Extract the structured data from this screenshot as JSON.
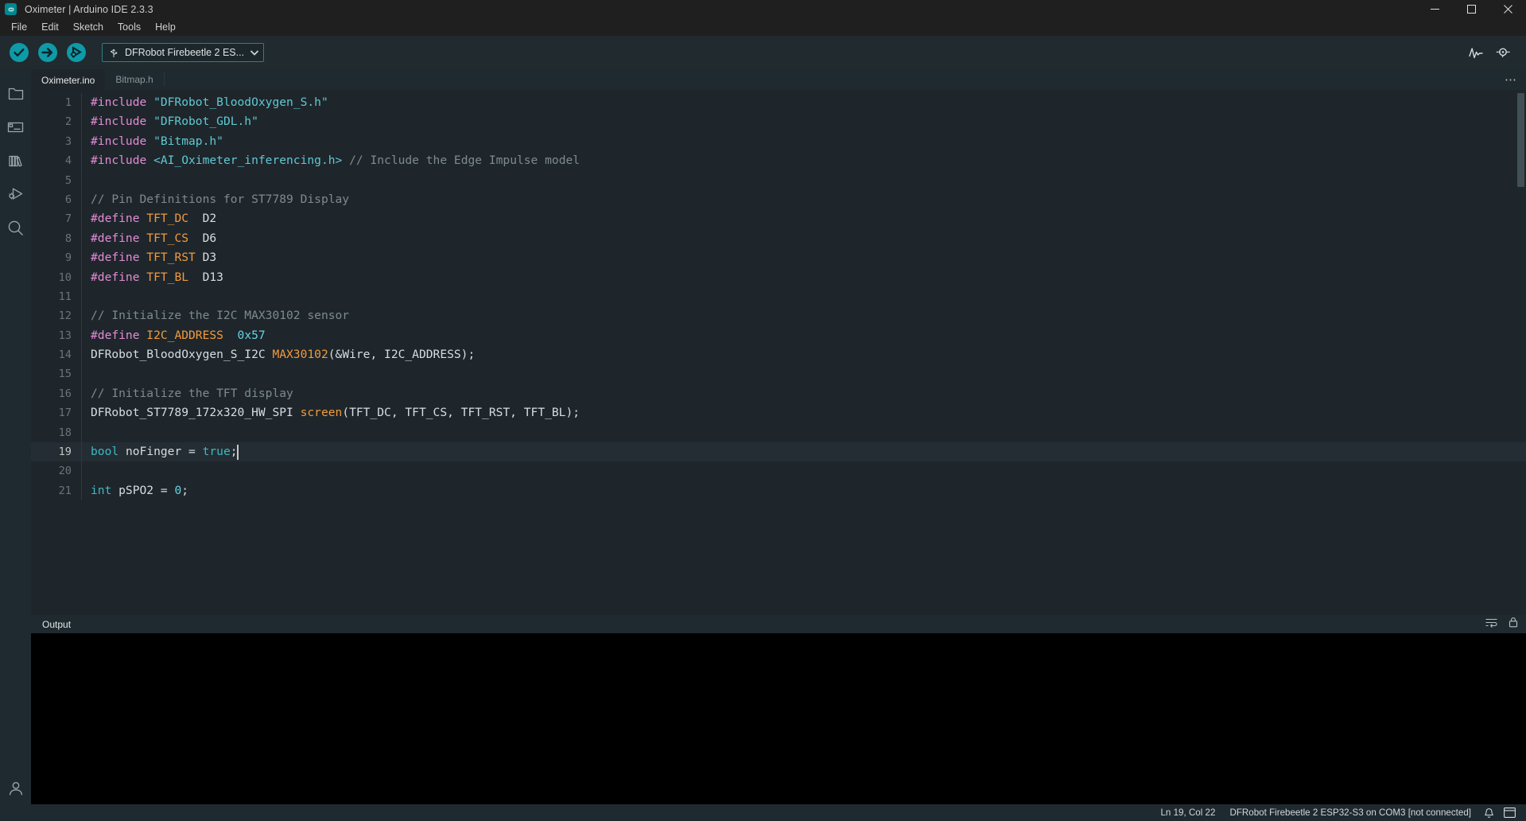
{
  "window": {
    "title": "Oximeter | Arduino IDE 2.3.3",
    "logo_icon": "arduino-infinity-logo",
    "minimize_icon": "minimize-icon",
    "maximize_icon": "maximize-icon",
    "close_icon": "close-icon"
  },
  "menubar": {
    "items": [
      {
        "label": "File",
        "name": "menu-file"
      },
      {
        "label": "Edit",
        "name": "menu-edit"
      },
      {
        "label": "Sketch",
        "name": "menu-sketch"
      },
      {
        "label": "Tools",
        "name": "menu-tools"
      },
      {
        "label": "Help",
        "name": "menu-help"
      }
    ]
  },
  "toolbar": {
    "verify_icon": "verify-checkmark-icon",
    "upload_icon": "upload-arrow-icon",
    "debug_icon": "debug-icon",
    "board_selector": {
      "usb_icon": "usb-icon",
      "value": "DFRobot Firebeetle 2 ES...",
      "caret_icon": "chevron-down-icon"
    },
    "serial_plotter_icon": "serial-plotter-icon",
    "serial_monitor_icon": "serial-monitor-icon"
  },
  "activitybar": {
    "items": [
      {
        "label": "Sketchbook",
        "name": "sidebar-item-sketchbook",
        "icon": "folder-icon"
      },
      {
        "label": "Boards Manager",
        "name": "sidebar-item-boards-manager",
        "icon": "board-icon"
      },
      {
        "label": "Library Manager",
        "name": "sidebar-item-library-manager",
        "icon": "library-books-icon"
      },
      {
        "label": "Debug",
        "name": "sidebar-item-debug",
        "icon": "debug-play-bug-icon"
      },
      {
        "label": "Search",
        "name": "sidebar-item-search",
        "icon": "search-icon"
      }
    ],
    "account_icon": "account-person-icon"
  },
  "tabs": {
    "items": [
      {
        "label": "Oximeter.ino",
        "name": "tab-oximeter-ino",
        "active": true
      },
      {
        "label": "Bitmap.h",
        "name": "tab-bitmap-h",
        "active": false
      }
    ],
    "more_label": "⋯"
  },
  "editor": {
    "current_line": 19,
    "lines": [
      {
        "n": "1",
        "tokens": [
          {
            "t": "#include ",
            "c": "t-pre"
          },
          {
            "t": "\"DFRobot_BloodOxygen_S.h\"",
            "c": "t-str"
          }
        ]
      },
      {
        "n": "2",
        "tokens": [
          {
            "t": "#include ",
            "c": "t-pre"
          },
          {
            "t": "\"DFRobot_GDL.h\"",
            "c": "t-str"
          }
        ]
      },
      {
        "n": "3",
        "tokens": [
          {
            "t": "#include ",
            "c": "t-pre"
          },
          {
            "t": "\"Bitmap.h\"",
            "c": "t-str"
          }
        ]
      },
      {
        "n": "4",
        "tokens": [
          {
            "t": "#include ",
            "c": "t-pre"
          },
          {
            "t": "<AI_Oximeter_inferencing.h>",
            "c": "t-str"
          },
          {
            "t": " ",
            "c": "t-txt"
          },
          {
            "t": "// Include the Edge Impulse model",
            "c": "t-cmt"
          }
        ]
      },
      {
        "n": "5",
        "tokens": []
      },
      {
        "n": "6",
        "tokens": [
          {
            "t": "// Pin Definitions for ST7789 Display",
            "c": "t-cmt"
          }
        ]
      },
      {
        "n": "7",
        "tokens": [
          {
            "t": "#define ",
            "c": "t-pre"
          },
          {
            "t": "TFT_DC",
            "c": "t-mac"
          },
          {
            "t": "  D2",
            "c": "t-txt"
          }
        ]
      },
      {
        "n": "8",
        "tokens": [
          {
            "t": "#define ",
            "c": "t-pre"
          },
          {
            "t": "TFT_CS",
            "c": "t-mac"
          },
          {
            "t": "  D6",
            "c": "t-txt"
          }
        ]
      },
      {
        "n": "9",
        "tokens": [
          {
            "t": "#define ",
            "c": "t-pre"
          },
          {
            "t": "TFT_RST",
            "c": "t-mac"
          },
          {
            "t": " D3",
            "c": "t-txt"
          }
        ]
      },
      {
        "n": "10",
        "tokens": [
          {
            "t": "#define ",
            "c": "t-pre"
          },
          {
            "t": "TFT_BL",
            "c": "t-mac"
          },
          {
            "t": "  D13",
            "c": "t-txt"
          }
        ]
      },
      {
        "n": "11",
        "tokens": []
      },
      {
        "n": "12",
        "tokens": [
          {
            "t": "// Initialize the I2C MAX30102 sensor",
            "c": "t-cmt"
          }
        ]
      },
      {
        "n": "13",
        "tokens": [
          {
            "t": "#define ",
            "c": "t-pre"
          },
          {
            "t": "I2C_ADDRESS",
            "c": "t-mac"
          },
          {
            "t": "  ",
            "c": "t-txt"
          },
          {
            "t": "0x57",
            "c": "t-num"
          }
        ]
      },
      {
        "n": "14",
        "tokens": [
          {
            "t": "DFRobot_BloodOxygen_S_I2C ",
            "c": "t-id"
          },
          {
            "t": "MAX30102",
            "c": "t-mac"
          },
          {
            "t": "(&Wire, I2C_ADDRESS);",
            "c": "t-txt"
          }
        ]
      },
      {
        "n": "15",
        "tokens": []
      },
      {
        "n": "16",
        "tokens": [
          {
            "t": "// Initialize the TFT display",
            "c": "t-cmt"
          }
        ]
      },
      {
        "n": "17",
        "tokens": [
          {
            "t": "DFRobot_ST7789_172x320_HW_SPI ",
            "c": "t-id"
          },
          {
            "t": "screen",
            "c": "t-mac"
          },
          {
            "t": "(TFT_DC, TFT_CS, TFT_RST, TFT_BL);",
            "c": "t-txt"
          }
        ]
      },
      {
        "n": "18",
        "tokens": []
      },
      {
        "n": "19",
        "tokens": [
          {
            "t": "bool",
            "c": "t-kw"
          },
          {
            "t": " noFinger = ",
            "c": "t-txt"
          },
          {
            "t": "true",
            "c": "t-kw"
          },
          {
            "t": ";",
            "c": "t-txt"
          }
        ]
      },
      {
        "n": "20",
        "tokens": []
      },
      {
        "n": "21",
        "tokens": [
          {
            "t": "int",
            "c": "t-kw"
          },
          {
            "t": " pSPO2 = ",
            "c": "t-txt"
          },
          {
            "t": "0",
            "c": "t-num"
          },
          {
            "t": ";",
            "c": "t-txt"
          }
        ]
      }
    ]
  },
  "output_panel": {
    "title": "Output",
    "wrap_icon": "word-wrap-icon",
    "lock_icon": "lock-scroll-icon",
    "content": ""
  },
  "statusbar": {
    "cursor_position": "Ln 19, Col 22",
    "board_status": "DFRobot Firebeetle 2 ESP32-S3 on COM3 [not connected]",
    "notification_icon": "bell-icon",
    "panel_toggle_icon": "panel-layout-icon"
  },
  "colors": {
    "accent": "#00979d",
    "editor_bg": "#1e262b",
    "chrome_bg": "#1f2a30",
    "titlebar_bg": "#1f1f1f",
    "output_bg": "#000000"
  }
}
